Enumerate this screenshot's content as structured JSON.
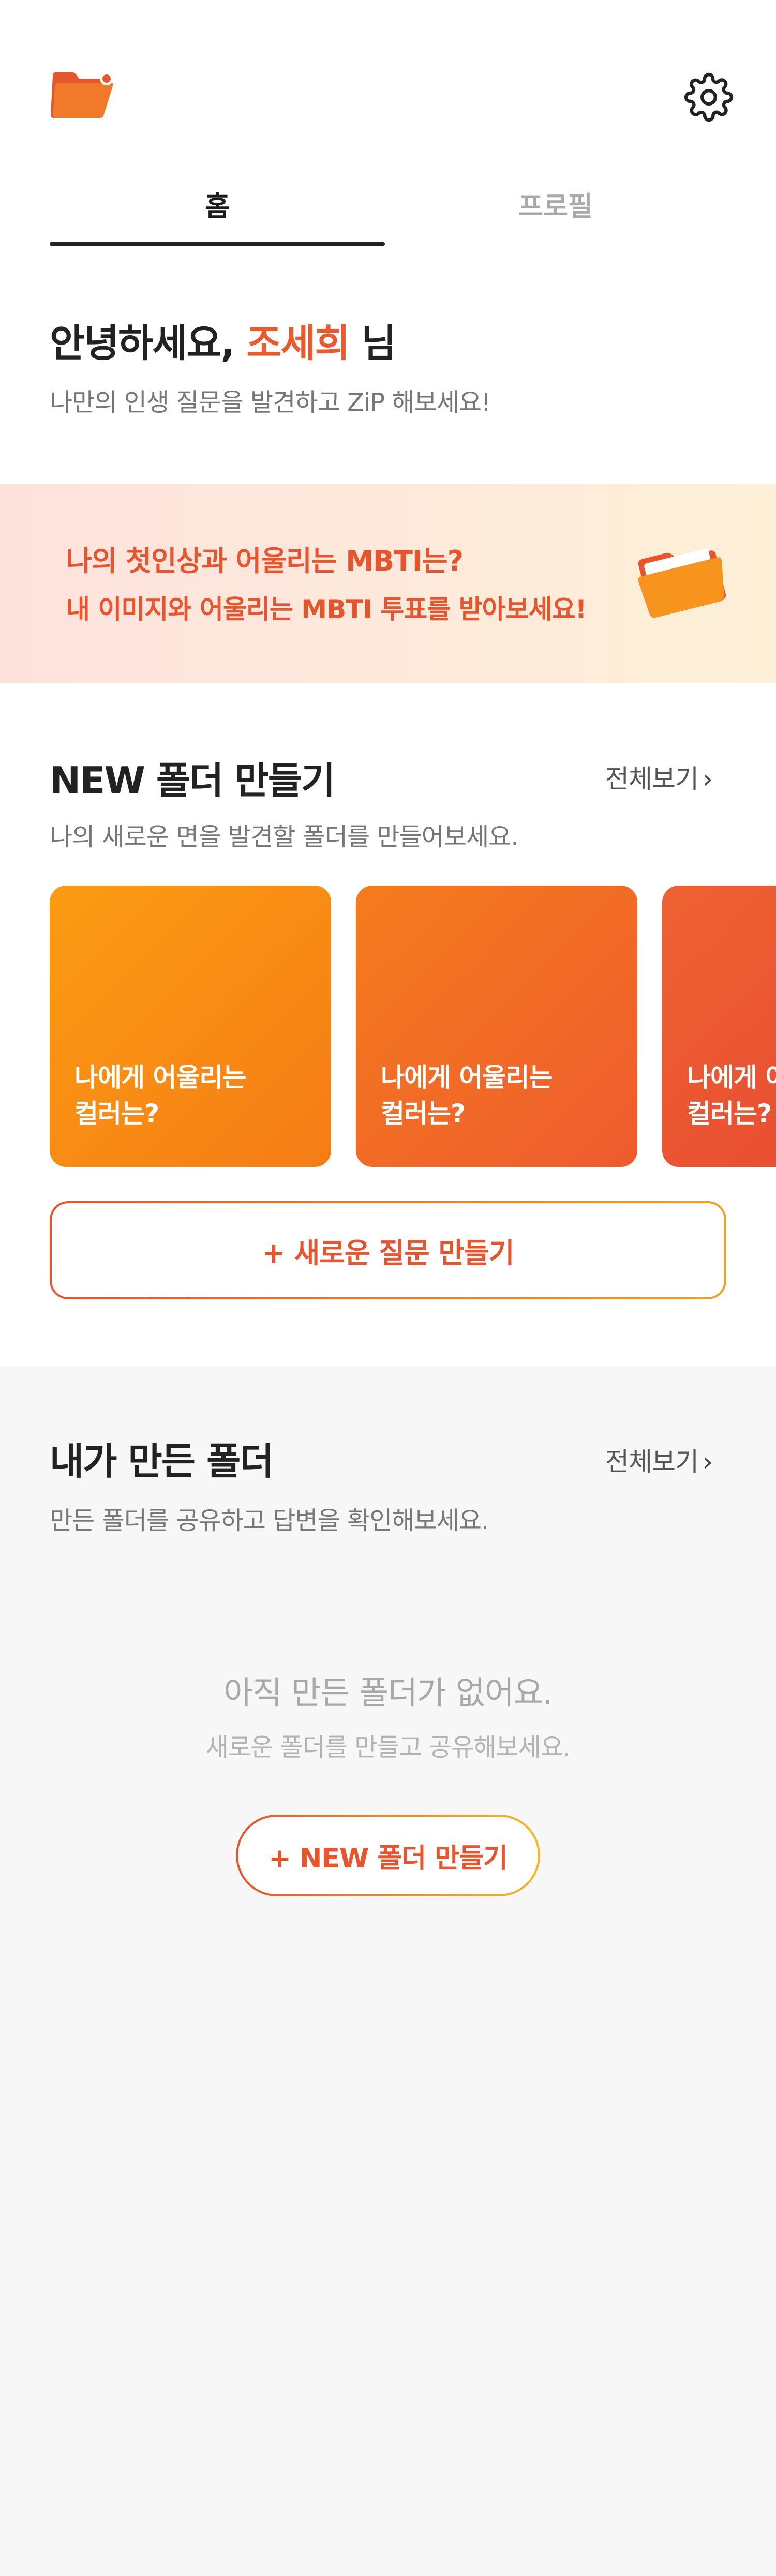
{
  "header": {
    "logo_icon": "folder-logo-icon",
    "settings_icon": "gear-icon"
  },
  "tabs": [
    {
      "label": "홈",
      "active": true
    },
    {
      "label": "프로필",
      "active": false
    }
  ],
  "greeting": {
    "prefix": "안녕하세요, ",
    "name": "조세희",
    "suffix": " 님",
    "subtitle": "나만의 인생 질문을 발견하고 ZiP 해보세요!"
  },
  "banner": {
    "title": "나의 첫인상과 어울리는 MBTI는?",
    "subtitle": "내 이미지와 어울리는 MBTI 투표를 받아보세요!",
    "icon": "orange-folder-icon"
  },
  "new_folder_section": {
    "title": "NEW 폴더 만들기",
    "see_all": "전체보기",
    "subtitle": "나의 새로운 면을 발견할 폴더를 만들어보세요.",
    "cards": [
      {
        "line1": "나에게 어울리는",
        "line2": "컬러는?"
      },
      {
        "line1": "나에게 어울리는",
        "line2": "컬러는?"
      },
      {
        "line1": "나에게 어울리는",
        "line2": "컬러는?"
      }
    ],
    "new_question_button": "+ 새로운 질문 만들기"
  },
  "my_folders_section": {
    "title": "내가 만든 폴더",
    "see_all": "전체보기",
    "subtitle": "만든 폴더를 공유하고 답변을 확인해보세요.",
    "empty_title": "아직 만든 폴더가 없어요.",
    "empty_subtitle": "새로운 폴더를 만들고 공유해보세요.",
    "new_folder_button": "+ NEW 폴더 만들기"
  },
  "colors": {
    "accent": "#e8542b",
    "accent_orange": "#f5901a",
    "text_dark": "#222222",
    "text_muted": "#777777",
    "section_bg": "#f7f7f7"
  }
}
